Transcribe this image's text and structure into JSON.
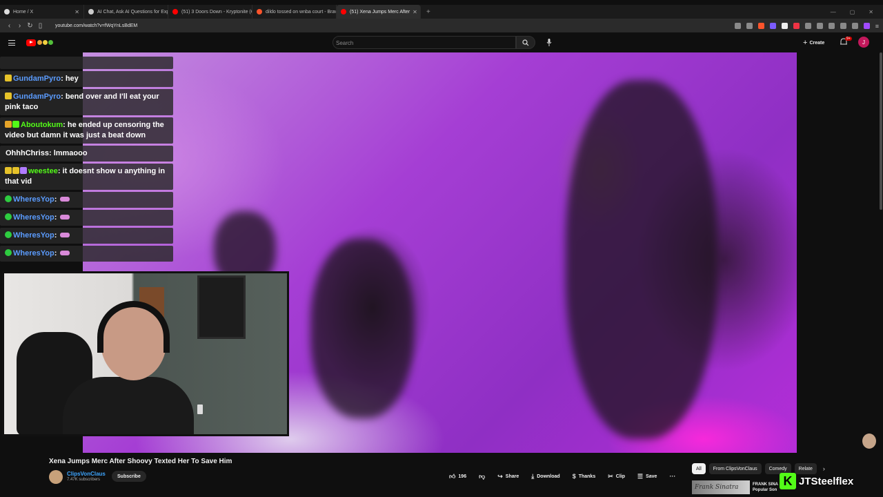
{
  "browser": {
    "tabs": [
      {
        "label": "Home / X",
        "favicon": "x-logo-icon",
        "color": "#dddddd"
      },
      {
        "label": "AI Chat, Ask AI Questions for Expert",
        "favicon": "ai-chat-icon",
        "color": "#cccccc"
      },
      {
        "label": "(51) 3 Doors Down - Kryptonite (Offi",
        "favicon": "youtube-icon",
        "color": "#ff0000"
      },
      {
        "label": "dildo tossed on wnba court - Brave",
        "favicon": "brave-search-icon",
        "color": "#fb542b"
      },
      {
        "label": "(51) Xena Jumps Merc After",
        "favicon": "youtube-icon",
        "color": "#ff0000",
        "active": true
      }
    ],
    "url": "youtube.com/watch?v=fWqYnLsBdEM"
  },
  "youtube": {
    "search_placeholder": "Search",
    "create_label": "Create",
    "notification_count": "9+",
    "account_initial": "J"
  },
  "chat": {
    "messages": [
      {
        "user": "GundamPyro",
        "user_color": "#5b9cff",
        "text": "hey",
        "badges": [
          "#e6c229"
        ]
      },
      {
        "user": "GundamPyro",
        "user_color": "#5b9cff",
        "text": "bend over and I'll eat your pink taco",
        "badges": [
          "#e6c229"
        ]
      },
      {
        "user": "Aboutokum",
        "user_color": "#53fc18",
        "text": "he ended up censoring the video but damn it was just a beat down",
        "badges": [
          "#e6a429",
          "#53fc18"
        ]
      },
      {
        "user": "OhhhChriss",
        "user_color": "#ffffff",
        "text": "lmmaooo",
        "badges": []
      },
      {
        "user": "weestee",
        "user_color": "#53fc18",
        "text": "it doesnt show u anything in that vid",
        "badges": [
          "#e6c229",
          "#e6c229",
          "#b07cff"
        ]
      },
      {
        "user": "WheresYop",
        "user_color": "#5b9cff",
        "text": "",
        "badges": [
          "#2ecc40"
        ],
        "emote": true
      },
      {
        "user": "WheresYop",
        "user_color": "#5b9cff",
        "text": "",
        "badges": [
          "#2ecc40"
        ],
        "emote": true
      },
      {
        "user": "WheresYop",
        "user_color": "#5b9cff",
        "text": "",
        "badges": [
          "#2ecc40"
        ],
        "emote": true
      },
      {
        "user": "WheresYop",
        "user_color": "#5b9cff",
        "text": "",
        "badges": [
          "#2ecc40"
        ],
        "emote": true
      }
    ]
  },
  "video": {
    "title": "Xena Jumps Merc After Shoovy Texted Her To Save Him",
    "channel": "ClipsVonClaus",
    "subscribers": "7.47K subscribers",
    "subscribe_label": "Subscribe",
    "likes": "196",
    "share_label": "Share",
    "download_label": "Download",
    "thanks_label": "Thanks",
    "clip_label": "Clip",
    "save_label": "Save"
  },
  "recommendations": {
    "chips": [
      "All",
      "From ClipsVonClaus",
      "Comedy",
      "Relate"
    ],
    "first_thumb_text": "Frank Sinatra",
    "first_title": "FRANK SINA Popular Son"
  },
  "watermark": {
    "letter": "K",
    "name": "JTSteelflex",
    "color": "#53fc18"
  }
}
